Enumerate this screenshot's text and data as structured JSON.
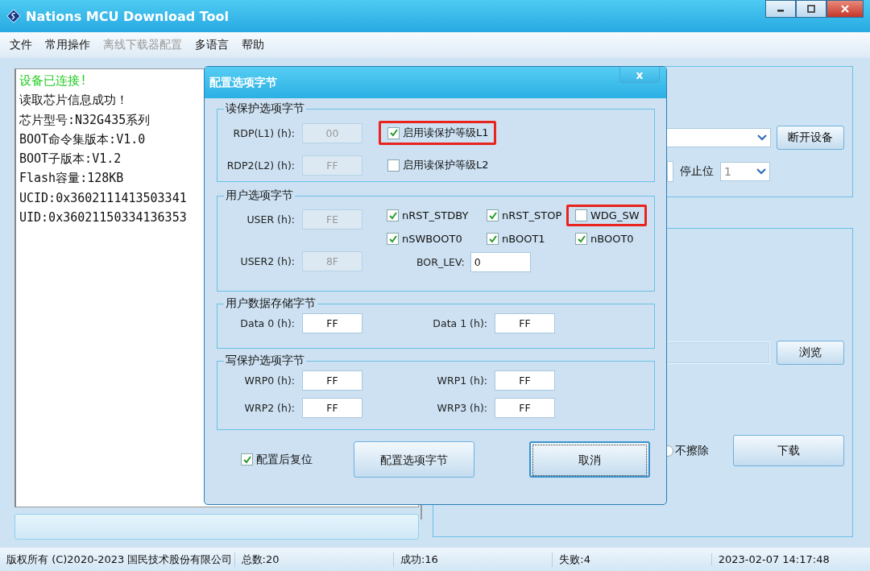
{
  "window": {
    "title": "Nations MCU Download Tool"
  },
  "menu": [
    {
      "label": "文件",
      "disabled": false
    },
    {
      "label": "常用操作",
      "disabled": false
    },
    {
      "label": "离线下载器配置",
      "disabled": true
    },
    {
      "label": "多语言",
      "disabled": false
    },
    {
      "label": "帮助",
      "disabled": false
    }
  ],
  "log": [
    {
      "text": "设备已连接!",
      "kind": "success"
    },
    {
      "text": "读取芯片信息成功！",
      "kind": "info"
    },
    {
      "text": "芯片型号:N32G435系列",
      "kind": "info"
    },
    {
      "text": "BOOT命令集版本:V1.0",
      "kind": "info"
    },
    {
      "text": "BOOT子版本:V1.2",
      "kind": "info"
    },
    {
      "text": "Flash容量:128KB",
      "kind": "info"
    },
    {
      "text": "UCID:0x3602111413503341",
      "kind": "info"
    },
    {
      "text": "UID:0x36021150334136353",
      "kind": "info"
    }
  ],
  "progress": {
    "level": 0
  },
  "device_panel": {
    "disconnect_button": "断开设备",
    "stop_bits_label": "停止位",
    "stop_bits_value": "1"
  },
  "download_panel": {
    "browse_button": "浏览",
    "erase_option": {
      "label": "不擦除"
    },
    "download_button": "下载"
  },
  "dialog": {
    "title": "配置选项字节",
    "close": "x",
    "read_protection": {
      "title": "读保护选项字节",
      "fields": [
        {
          "label": "RDP(L1)  (h):",
          "value": "00",
          "disabled": true
        },
        {
          "label": "RDP2(L2) (h):",
          "value": "FF",
          "disabled": true
        }
      ],
      "checkboxes": [
        {
          "label": "启用读保护等级L1",
          "checked": true,
          "highlighted": true
        },
        {
          "label": "启用读保护等级L2",
          "checked": false,
          "highlighted": false
        }
      ]
    },
    "user_options": {
      "title": "用户选项字节",
      "fields": [
        {
          "label": "USER (h):",
          "value": "FE",
          "disabled": true
        },
        {
          "label": "USER2 (h):",
          "value": "8F",
          "disabled": true
        }
      ],
      "checkboxes": [
        {
          "label": "nRST_STDBY",
          "checked": true,
          "highlighted": false
        },
        {
          "label": "nRST_STOP",
          "checked": true,
          "highlighted": false
        },
        {
          "label": "WDG_SW",
          "checked": false,
          "highlighted": true
        },
        {
          "label": "nSWBOOT0",
          "checked": true,
          "highlighted": false
        },
        {
          "label": "nBOOT1",
          "checked": true,
          "highlighted": false
        },
        {
          "label": "nBOOT0",
          "checked": true,
          "highlighted": false
        }
      ],
      "bor_lev": {
        "label": "BOR_LEV:",
        "value": "0"
      }
    },
    "data_storage": {
      "title": "用户数据存储字节",
      "fields": [
        {
          "label": "Data 0 (h):",
          "value": "FF"
        },
        {
          "label": "Data 1 (h):",
          "value": "FF"
        }
      ]
    },
    "write_protection": {
      "title": "写保护选项字节",
      "fields": [
        {
          "label": "WRP0 (h):",
          "value": "FF"
        },
        {
          "label": "WRP1 (h):",
          "value": "FF"
        },
        {
          "label": "WRP2 (h):",
          "value": "FF"
        },
        {
          "label": "WRP3 (h):",
          "value": "FF"
        }
      ]
    },
    "reset_after": {
      "label": "配置后复位",
      "checked": true
    },
    "buttons": [
      {
        "label": "配置选项字节",
        "focused": false
      },
      {
        "label": "取消",
        "focused": true
      }
    ]
  },
  "status_bar": [
    "版权所有 (C)2020-2023 国民技术股份有限公司",
    "总数:20",
    "成功:16",
    "失败:4",
    "2023-02-07 14:17:48"
  ]
}
